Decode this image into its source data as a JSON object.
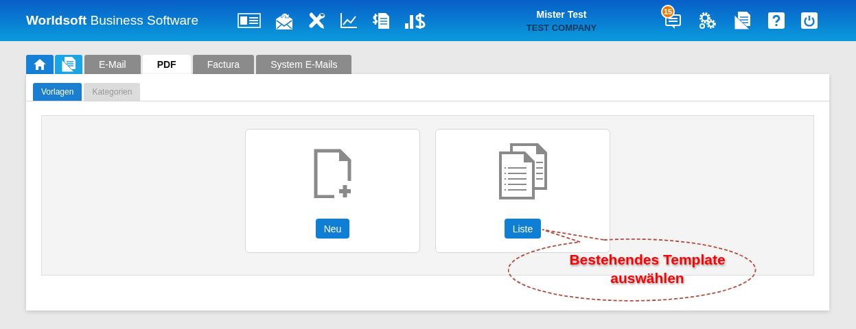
{
  "header": {
    "brand_bold": "Worldsoft",
    "brand_rest": "Business Software",
    "user_name": "Mister Test",
    "company": "TEST COMPANY",
    "notification_count": "15"
  },
  "tabs": [
    {
      "kind": "home",
      "selected": false
    },
    {
      "kind": "docs",
      "selected": false
    },
    {
      "kind": "text",
      "label": "E-Mail",
      "selected": false
    },
    {
      "kind": "text",
      "label": "PDF",
      "selected": true
    },
    {
      "kind": "text",
      "label": "Factura",
      "selected": false
    },
    {
      "kind": "text",
      "label": "System E-Mails",
      "selected": false
    }
  ],
  "subtabs": [
    {
      "label": "Vorlagen",
      "selected": true
    },
    {
      "label": "Kategorien",
      "selected": false
    }
  ],
  "cards": [
    {
      "kind": "new",
      "button": "Neu"
    },
    {
      "kind": "list",
      "button": "Liste"
    }
  ],
  "callout": {
    "text": "Bestehendes Template\nauswählen"
  }
}
